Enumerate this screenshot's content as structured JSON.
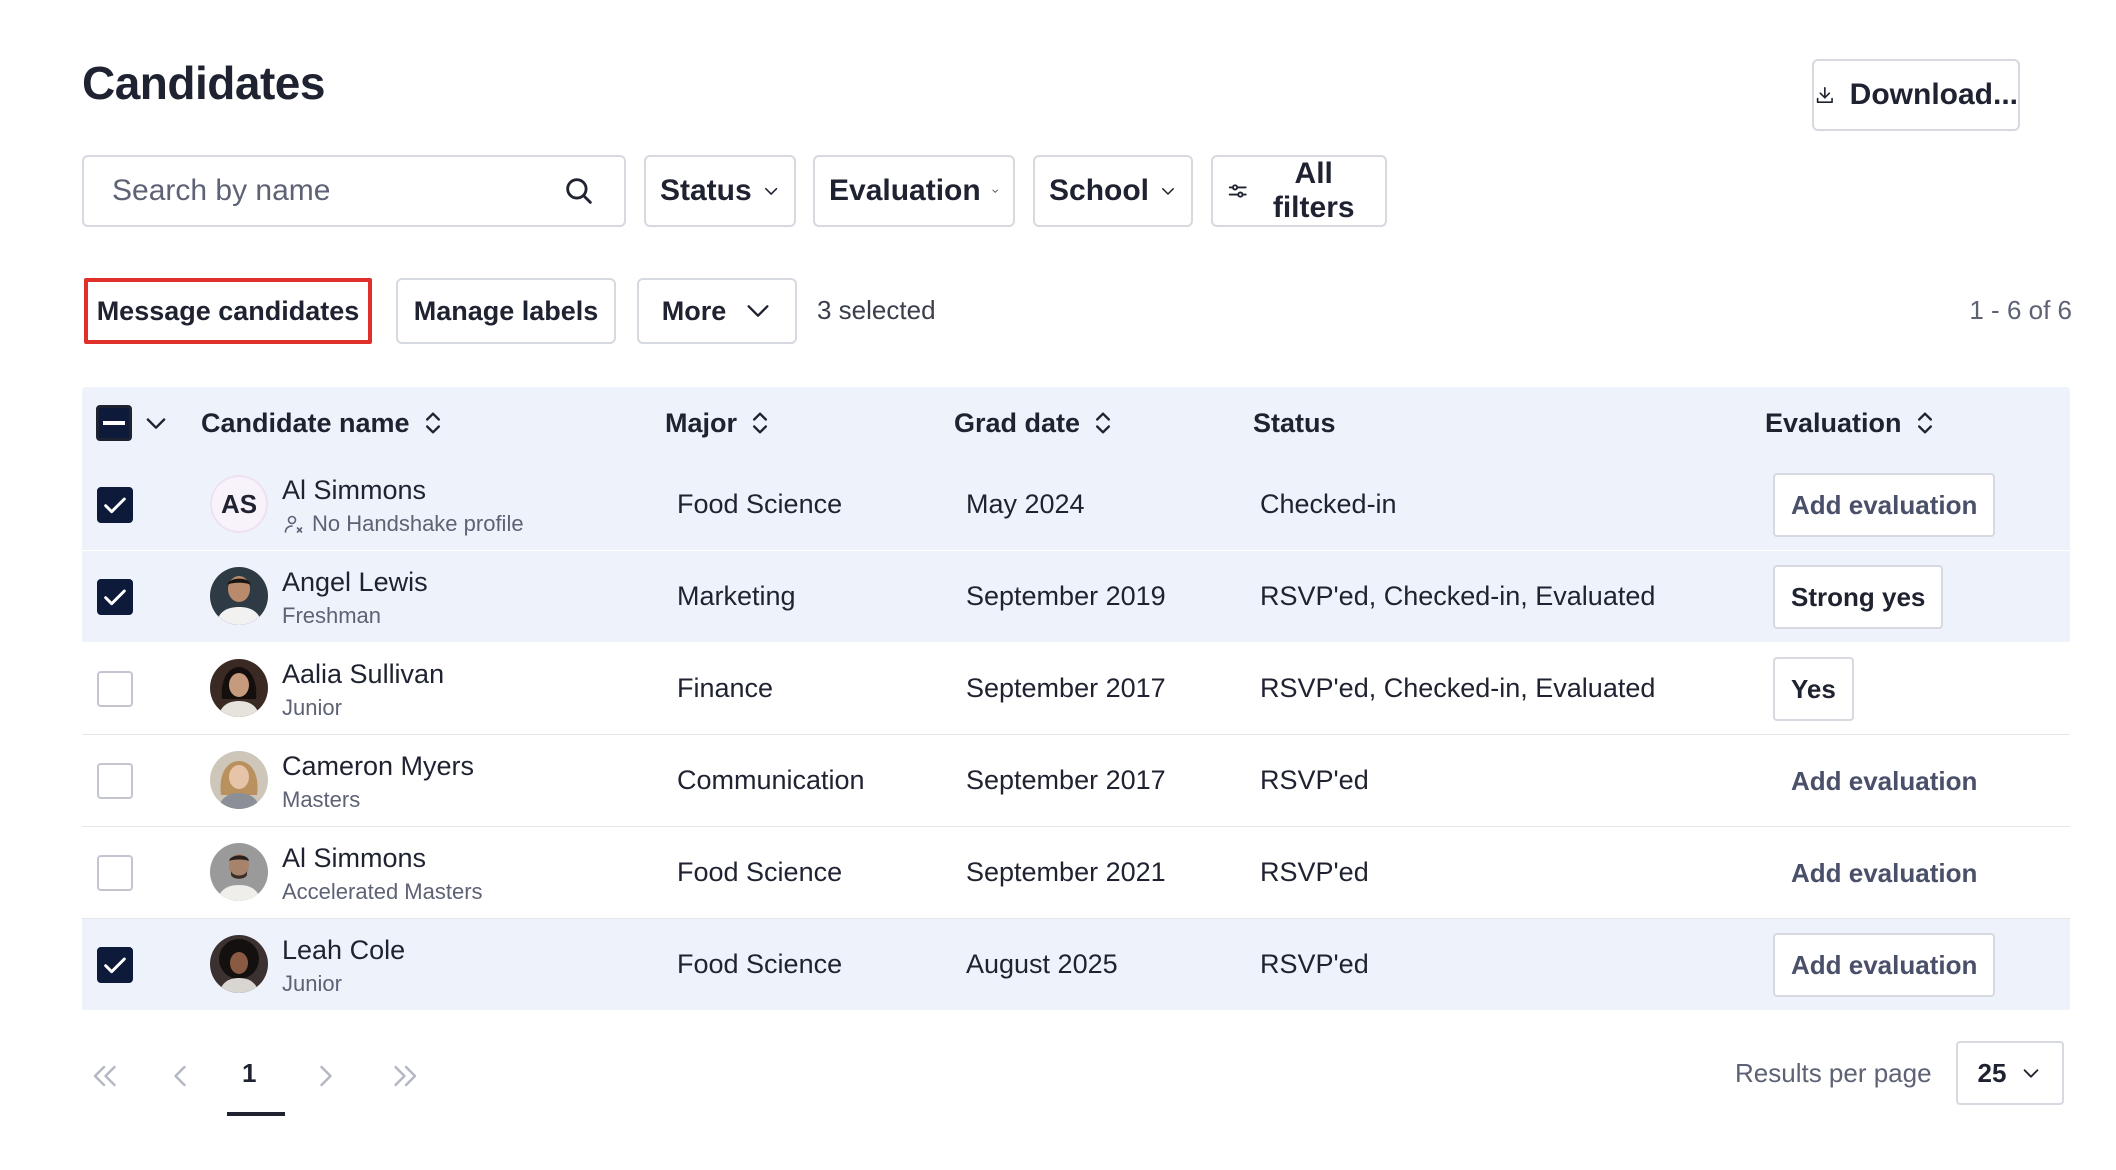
{
  "page": {
    "title": "Candidates"
  },
  "toolbar": {
    "download_label": "Download..."
  },
  "search": {
    "placeholder": "Search by name"
  },
  "filters": {
    "status": "Status",
    "evaluation": "Evaluation",
    "school": "School",
    "all": "All filters"
  },
  "actions": {
    "message": "Message candidates",
    "labels": "Manage labels",
    "more": "More",
    "selected": "3 selected",
    "range": "1 - 6 of 6"
  },
  "table": {
    "columns": {
      "name": "Candidate name",
      "major": "Major",
      "grad": "Grad date",
      "status": "Status",
      "evaluation": "Evaluation"
    },
    "rows": [
      {
        "selected": true,
        "initials": "AS",
        "name": "Al Simmons",
        "sub": "No Handshake profile",
        "major": "Food Science",
        "grad": "May 2024",
        "status": "Checked-in",
        "evaluation": "Add evaluation"
      },
      {
        "selected": true,
        "name": "Angel Lewis",
        "sub": "Freshman",
        "major": "Marketing",
        "grad": "September 2019",
        "status": "RSVP'ed, Checked-in, Evaluated",
        "evaluation": "Strong yes"
      },
      {
        "selected": false,
        "name": "Aalia Sullivan",
        "sub": "Junior",
        "major": "Finance",
        "grad": "September 2017",
        "status": "RSVP'ed, Checked-in, Evaluated",
        "evaluation": "Yes"
      },
      {
        "selected": false,
        "name": "Cameron Myers",
        "sub": "Masters",
        "major": "Communication",
        "grad": "September 2017",
        "status": "RSVP'ed",
        "evaluation": "Add evaluation"
      },
      {
        "selected": false,
        "name": "Al Simmons",
        "sub": "Accelerated Masters",
        "major": "Food Science",
        "grad": "September 2021",
        "status": "RSVP'ed",
        "evaluation": "Add evaluation"
      },
      {
        "selected": true,
        "name": "Leah Cole",
        "sub": "Junior",
        "major": "Food Science",
        "grad": "August 2025",
        "status": "RSVP'ed",
        "evaluation": "Add evaluation"
      }
    ]
  },
  "pagination": {
    "current": "1"
  },
  "results_per_page": {
    "label": "Results per page",
    "value": "25"
  },
  "icons": {
    "download": "download-icon",
    "search": "search-icon",
    "chevron": "chevron-down-icon",
    "filters": "sliders-icon",
    "sort": "sort-icon",
    "check": "check-icon",
    "no_profile": "user-x-icon",
    "first": "chevrons-left-icon",
    "prev": "chevron-left-icon",
    "next": "chevron-right-icon",
    "last": "chevrons-right-icon"
  },
  "colors": {
    "highlight": "#e0302a",
    "selected_row": "#eef2fb",
    "checkbox": "#0d1a3a"
  }
}
